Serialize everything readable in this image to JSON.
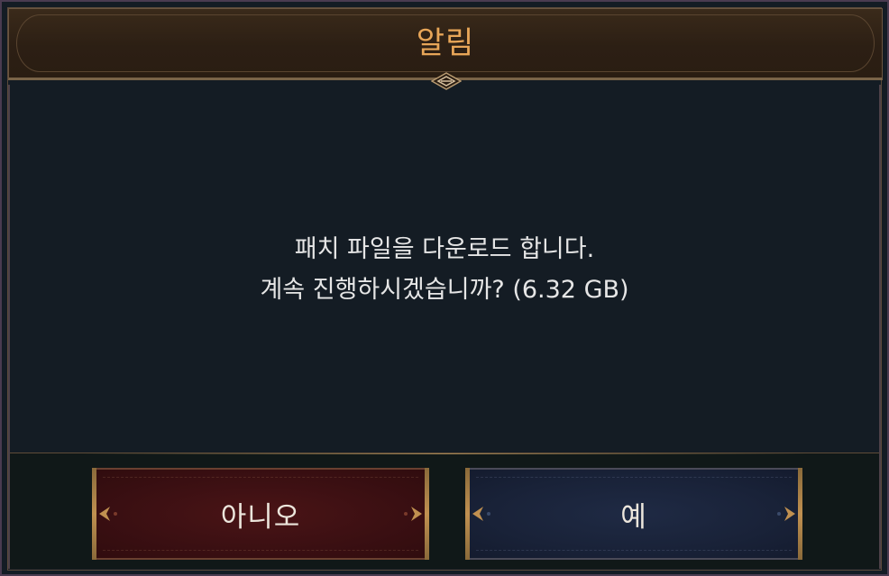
{
  "dialog": {
    "title": "알림",
    "message": {
      "line1": "패치 파일을 다운로드 합니다.",
      "line2": "계속 진행하시겠습니까? (6.32 GB)"
    },
    "buttons": {
      "no_label": "아니오",
      "yes_label": "예"
    }
  },
  "colors": {
    "title": "#e8a658",
    "background": "#141c24",
    "no_button": "#3a0f12",
    "yes_button": "#192238",
    "trim": "#c09050"
  },
  "icons": {
    "header_ornament": "diamond-ornament-icon",
    "button_corner": "arrow-ornament-icon"
  }
}
